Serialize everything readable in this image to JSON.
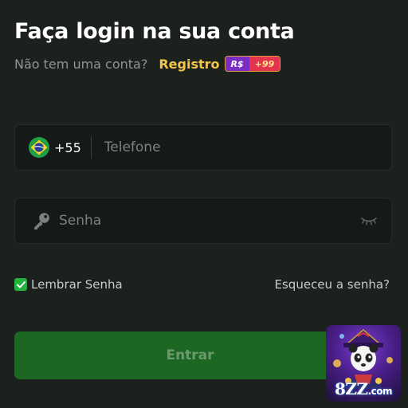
{
  "header": {
    "title": "Faça login na sua conta",
    "subtitle": "Não tem uma conta?",
    "register_label": "Registro",
    "bonus_currency": "R$",
    "bonus_amount": "+99"
  },
  "phone_field": {
    "flag": "brazil-flag-icon",
    "country_code": "+55",
    "placeholder": "Telefone",
    "value": ""
  },
  "password_field": {
    "icon": "key-icon",
    "placeholder": "Senha",
    "value": "",
    "toggle_icon": "eye-closed-icon"
  },
  "options": {
    "remember_checked": true,
    "remember_label": "Lembrar Senha",
    "forgot_label": "Esqueceu a senha?"
  },
  "submit": {
    "label": "Entrar"
  },
  "promo": {
    "brand_main": "8ZZ",
    "brand_suffix": ".com",
    "image": "panda-mascot"
  },
  "colors": {
    "background": "#1c211e",
    "accent_gold": "#f3c64a",
    "checkbox_green": "#22b33d",
    "button_green": "#1c6823"
  }
}
